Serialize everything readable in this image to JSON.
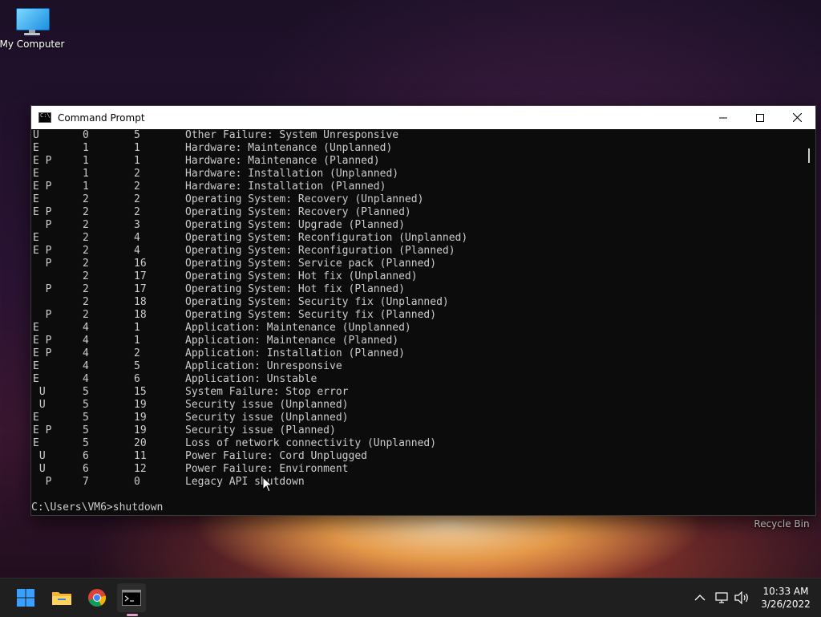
{
  "desktop": {
    "my_computer_label": "My Computer",
    "recycle_bin_label": "Recycle Bin"
  },
  "window": {
    "title": "Command Prompt"
  },
  "console": {
    "rows": [
      {
        "flags": "U",
        "major": "0",
        "minor": "5",
        "desc": "Other Failure: System Unresponsive"
      },
      {
        "flags": "E",
        "major": "1",
        "minor": "1",
        "desc": "Hardware: Maintenance (Unplanned)"
      },
      {
        "flags": "E P",
        "major": "1",
        "minor": "1",
        "desc": "Hardware: Maintenance (Planned)"
      },
      {
        "flags": "E",
        "major": "1",
        "minor": "2",
        "desc": "Hardware: Installation (Unplanned)"
      },
      {
        "flags": "E P",
        "major": "1",
        "minor": "2",
        "desc": "Hardware: Installation (Planned)"
      },
      {
        "flags": "E",
        "major": "2",
        "minor": "2",
        "desc": "Operating System: Recovery (Unplanned)"
      },
      {
        "flags": "E P",
        "major": "2",
        "minor": "2",
        "desc": "Operating System: Recovery (Planned)"
      },
      {
        "flags": "  P",
        "major": "2",
        "minor": "3",
        "desc": "Operating System: Upgrade (Planned)"
      },
      {
        "flags": "E",
        "major": "2",
        "minor": "4",
        "desc": "Operating System: Reconfiguration (Unplanned)"
      },
      {
        "flags": "E P",
        "major": "2",
        "minor": "4",
        "desc": "Operating System: Reconfiguration (Planned)"
      },
      {
        "flags": "  P",
        "major": "2",
        "minor": "16",
        "desc": "Operating System: Service pack (Planned)"
      },
      {
        "flags": "",
        "major": "2",
        "minor": "17",
        "desc": "Operating System: Hot fix (Unplanned)"
      },
      {
        "flags": "  P",
        "major": "2",
        "minor": "17",
        "desc": "Operating System: Hot fix (Planned)"
      },
      {
        "flags": "",
        "major": "2",
        "minor": "18",
        "desc": "Operating System: Security fix (Unplanned)"
      },
      {
        "flags": "  P",
        "major": "2",
        "minor": "18",
        "desc": "Operating System: Security fix (Planned)"
      },
      {
        "flags": "E",
        "major": "4",
        "minor": "1",
        "desc": "Application: Maintenance (Unplanned)"
      },
      {
        "flags": "E P",
        "major": "4",
        "minor": "1",
        "desc": "Application: Maintenance (Planned)"
      },
      {
        "flags": "E P",
        "major": "4",
        "minor": "2",
        "desc": "Application: Installation (Planned)"
      },
      {
        "flags": "E",
        "major": "4",
        "minor": "5",
        "desc": "Application: Unresponsive"
      },
      {
        "flags": "E",
        "major": "4",
        "minor": "6",
        "desc": "Application: Unstable"
      },
      {
        "flags": " U",
        "major": "5",
        "minor": "15",
        "desc": "System Failure: Stop error"
      },
      {
        "flags": " U",
        "major": "5",
        "minor": "19",
        "desc": "Security issue (Unplanned)"
      },
      {
        "flags": "E",
        "major": "5",
        "minor": "19",
        "desc": "Security issue (Unplanned)"
      },
      {
        "flags": "E P",
        "major": "5",
        "minor": "19",
        "desc": "Security issue (Planned)"
      },
      {
        "flags": "E",
        "major": "5",
        "minor": "20",
        "desc": "Loss of network connectivity (Unplanned)"
      },
      {
        "flags": " U",
        "major": "6",
        "minor": "11",
        "desc": "Power Failure: Cord Unplugged"
      },
      {
        "flags": " U",
        "major": "6",
        "minor": "12",
        "desc": "Power Failure: Environment"
      },
      {
        "flags": "  P",
        "major": "7",
        "minor": "0",
        "desc": "Legacy API shutdown"
      }
    ],
    "prompt": "C:\\Users\\VM6>shutdown"
  },
  "taskbar": {
    "time": "10:33 AM",
    "date": "3/26/2022"
  },
  "colors": {
    "console_bg": "#0c0c0c",
    "console_fg": "#cccccc",
    "taskbar_bg": "#1f1f1f",
    "accent_windows": "#3aa0ff"
  }
}
